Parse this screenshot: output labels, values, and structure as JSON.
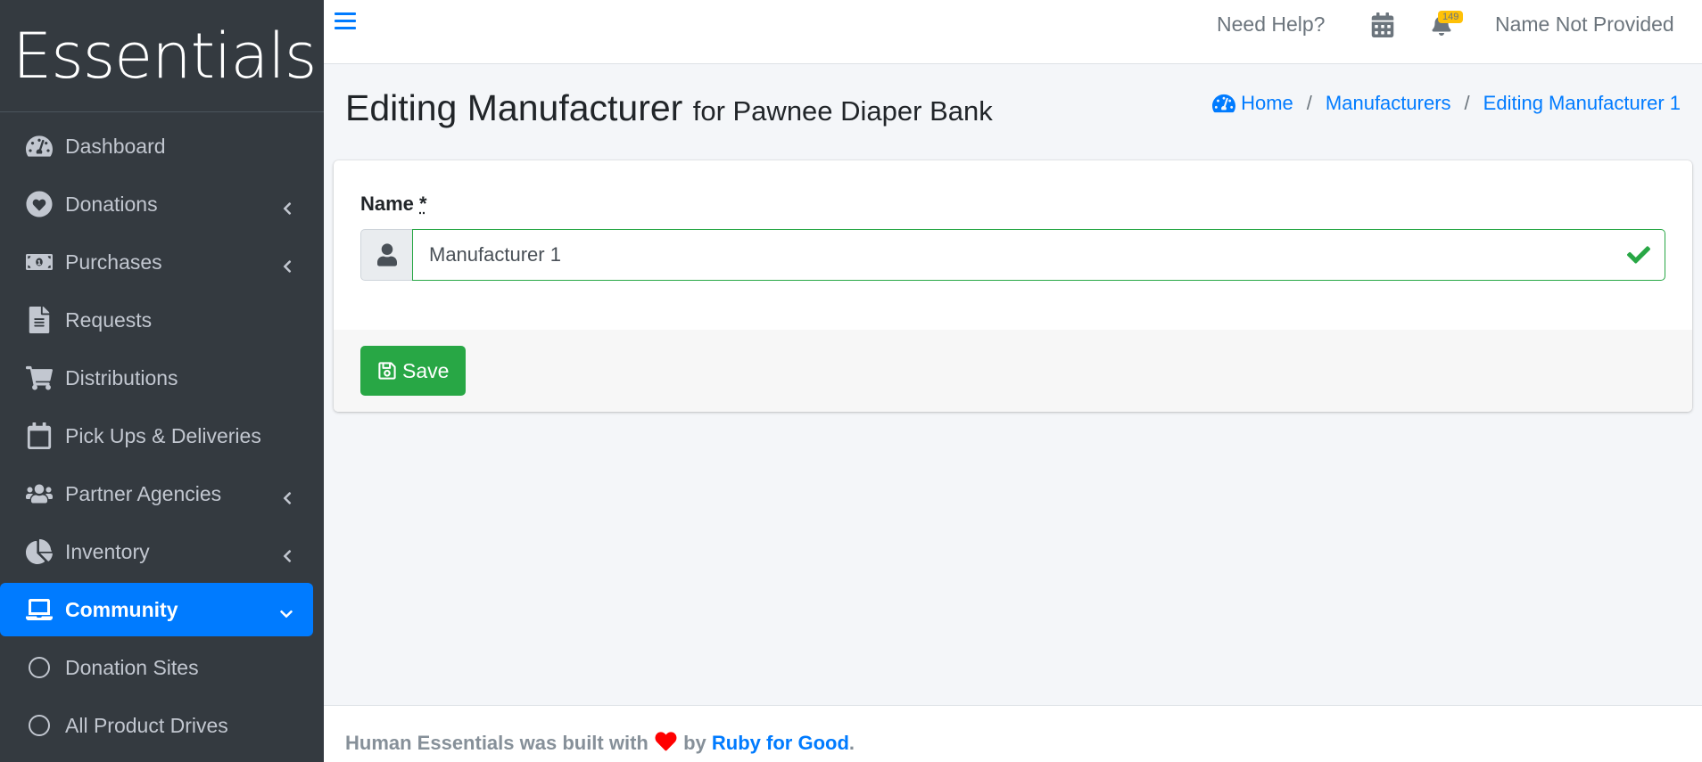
{
  "brand": {
    "name": "Essentials"
  },
  "sidebar": {
    "items": [
      {
        "label": "Dashboard",
        "icon": "tachometer-icon",
        "has_caret": false
      },
      {
        "label": "Donations",
        "icon": "heart-circle-icon",
        "has_caret": true
      },
      {
        "label": "Purchases",
        "icon": "money-bill-icon",
        "has_caret": true
      },
      {
        "label": "Requests",
        "icon": "file-icon",
        "has_caret": false
      },
      {
        "label": "Distributions",
        "icon": "shopping-cart-icon",
        "has_caret": false
      },
      {
        "label": "Pick Ups & Deliveries",
        "icon": "calendar-icon",
        "has_caret": false
      },
      {
        "label": "Partner Agencies",
        "icon": "users-icon",
        "has_caret": true
      },
      {
        "label": "Inventory",
        "icon": "pie-chart-icon",
        "has_caret": true
      },
      {
        "label": "Community",
        "icon": "laptop-icon",
        "has_caret": true,
        "active": true
      },
      {
        "label": "Donation Sites",
        "icon": "circle-icon",
        "has_caret": false
      },
      {
        "label": "All Product Drives",
        "icon": "circle-icon",
        "has_caret": false
      }
    ]
  },
  "topbar": {
    "help_label": "Need Help?",
    "notification_count": "149",
    "user_name": "Name Not Provided"
  },
  "header": {
    "title": "Editing Manufacturer",
    "subtitle": "for Pawnee Diaper Bank"
  },
  "breadcrumb": {
    "home": "Home",
    "manufacturers": "Manufacturers",
    "current": "Editing Manufacturer 1"
  },
  "form": {
    "name_label": "Name",
    "required_mark": "*",
    "name_value": "Manufacturer 1",
    "save_label": "Save"
  },
  "footer": {
    "text_before": "Human Essentials was built with",
    "text_by": "by",
    "link": "Ruby for Good",
    "period": "."
  },
  "colors": {
    "sidebar_bg": "#343a40",
    "accent": "#007bff",
    "success": "#28a745",
    "badge": "#ffc107"
  }
}
